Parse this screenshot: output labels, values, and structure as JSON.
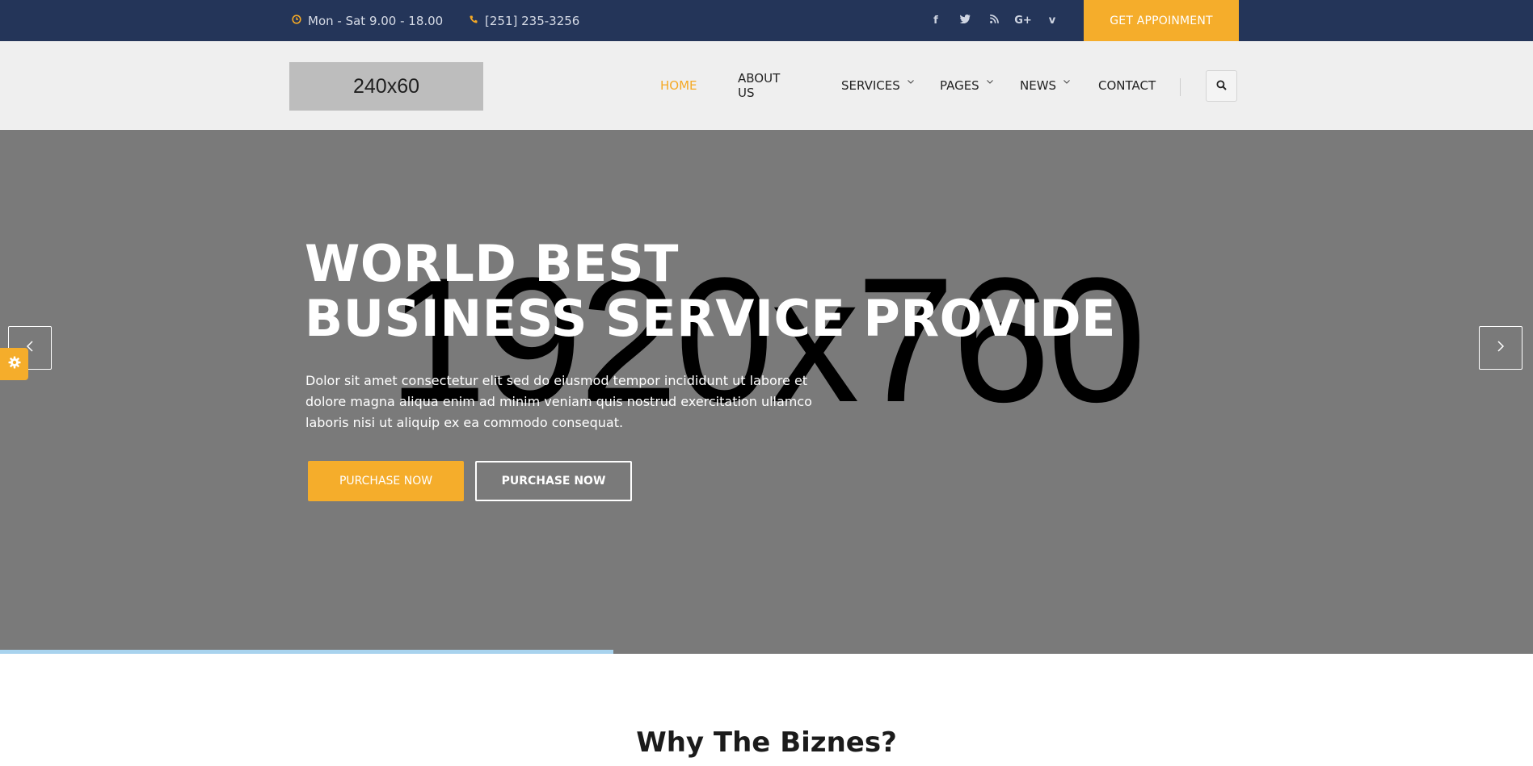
{
  "topbar": {
    "hours": "Mon - Sat 9.00 - 18.00",
    "phone": "[251] 235-3256",
    "social": [
      {
        "icon": "facebook-icon",
        "glyph": "f"
      },
      {
        "icon": "twitter-icon",
        "glyph": "t"
      },
      {
        "icon": "rss-icon",
        "glyph": "rss"
      },
      {
        "icon": "google-plus-icon",
        "glyph": "G+"
      },
      {
        "icon": "vimeo-icon",
        "glyph": "v"
      }
    ],
    "appointment_label": "GET APPOINMENT"
  },
  "header": {
    "logo_text": "240x60",
    "nav": [
      {
        "label": "HOME",
        "active": true,
        "dropdown": false
      },
      {
        "label": "ABOUT US",
        "active": false,
        "dropdown": false
      },
      {
        "label": "SERVICES",
        "active": false,
        "dropdown": true
      },
      {
        "label": "PAGES",
        "active": false,
        "dropdown": true
      },
      {
        "label": "NEWS",
        "active": false,
        "dropdown": true
      },
      {
        "label": "CONTACT",
        "active": false,
        "dropdown": false
      }
    ]
  },
  "hero": {
    "placeholder": "1920x760",
    "title_line1": "WORLD BEST",
    "title_line2": "BUSINESS SERVICE PROVIDE",
    "description": "Dolor sit amet consectetur elit sed do eiusmod tempor incididunt ut labore et dolore magna aliqua enim ad minim veniam quis nostrud exercitation ullamco laboris nisi ut aliquip ex ea commodo consequat.",
    "primary_button": "PURCHASE NOW",
    "secondary_button": "PURCHASE NOW",
    "progress": 0.4
  },
  "section": {
    "title": "Why The Biznes?"
  },
  "colors": {
    "topbar_bg": "#243559",
    "accent": "#f5ad2b",
    "header_bg": "#efefef",
    "hero_bg": "#7a7a7a",
    "progress": "#a8d3ee"
  }
}
